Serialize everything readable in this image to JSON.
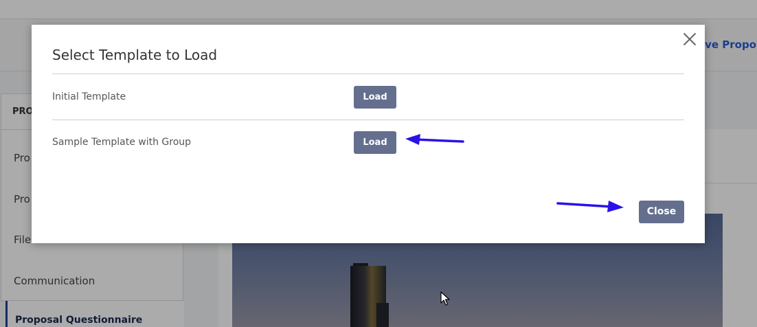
{
  "background": {
    "toolbar_link": "ave Propo",
    "sidebar_header": "PRO",
    "nav_items": [
      "Pro",
      "Pro",
      "File",
      "Communication"
    ],
    "active_nav": "Proposal Questionnaire"
  },
  "modal": {
    "title": "Select Template to Load",
    "rows": [
      {
        "label": "Initial Template",
        "button": "Load"
      },
      {
        "label": "Sample Template with Group",
        "button": "Load"
      }
    ],
    "close_label": "Close"
  },
  "colors": {
    "button": "#646f8e",
    "annotation_arrow": "#2b12e6",
    "link": "#2a5bd7"
  },
  "icons": {
    "close": "close-icon",
    "cursor": "mouse-pointer-icon"
  }
}
